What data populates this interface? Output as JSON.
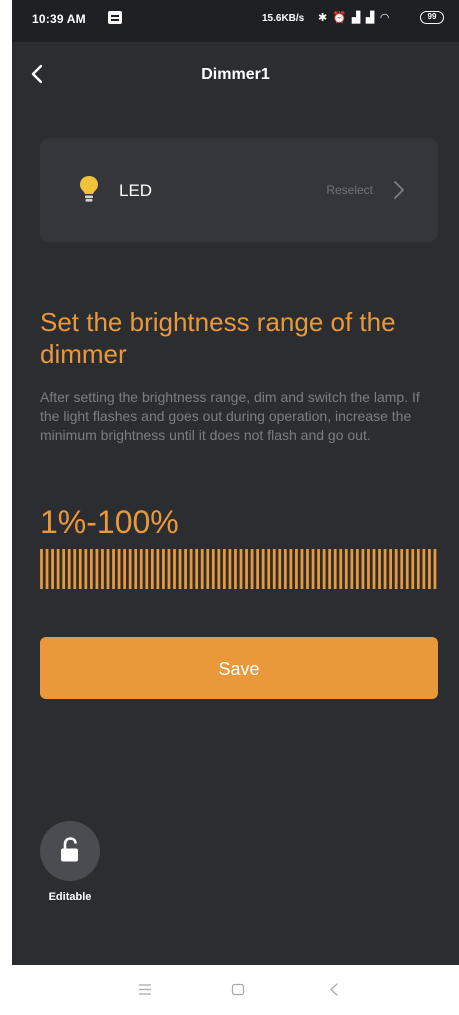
{
  "status_bar": {
    "time": "10:39 AM",
    "network_speed": "15.6KB/s",
    "icons": [
      "bluetooth-icon",
      "alarm-icon",
      "signal-icon",
      "signal-icon",
      "wifi-icon"
    ],
    "battery": "99"
  },
  "header": {
    "title": "Dimmer1",
    "back_icon": "back-arrow-icon"
  },
  "device_card": {
    "icon": "light-bulb-icon",
    "label": "LED",
    "action": "Reselect",
    "action_icon": "chevron-right-icon"
  },
  "brightness": {
    "title": "Set the brightness range of the dimmer",
    "description": "After setting the brightness range, dim and switch the lamp. If the light flashes and goes out during operation, increase the minimum brightness until it does not flash and go out.",
    "range_text": "1%-100%",
    "min_percent": 1,
    "max_percent": 100
  },
  "actions": {
    "save_label": "Save"
  },
  "lock": {
    "icon": "unlocked-padlock-icon",
    "label": "Editable"
  },
  "nav_bar": {
    "items": [
      "menu-icon",
      "home-icon",
      "back-icon"
    ]
  },
  "colors": {
    "background": "#2b2d31",
    "accent": "#e9983a",
    "card": "#34363b",
    "muted_text": "#7c7e83"
  }
}
